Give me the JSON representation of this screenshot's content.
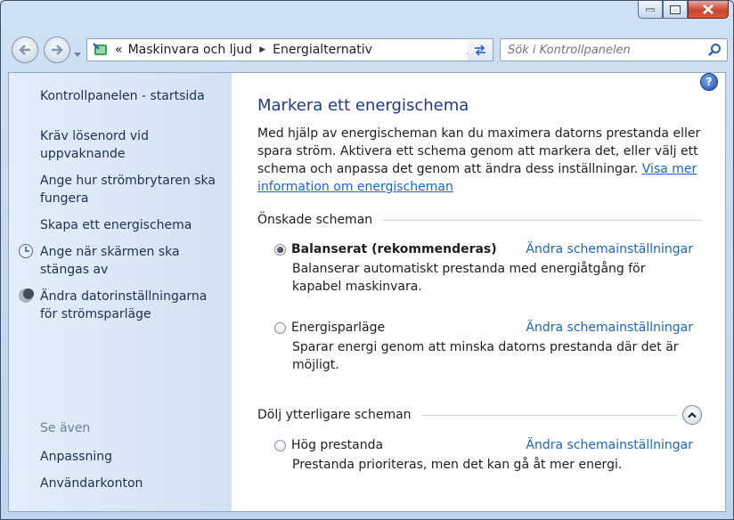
{
  "window": {
    "minimize_label": "minimize",
    "maximize_label": "maximize",
    "close_label": "close"
  },
  "address": {
    "overflow": "«",
    "breadcrumbs": [
      "Maskinvara och ljud",
      "Energialternativ"
    ]
  },
  "search": {
    "placeholder": "Sök i Kontrollpanelen"
  },
  "sidebar": {
    "home": "Kontrollpanelen - startsida",
    "items": [
      "Kräv lösenord vid uppvaknande",
      "Ange hur strömbrytaren ska fungera",
      "Skapa ett energischema",
      "Ange när skärmen ska stängas av",
      "Ändra datorinställningarna för strömsparläge"
    ],
    "see_also": "Se även",
    "see_also_items": [
      "Anpassning",
      "Användarkonton"
    ]
  },
  "main": {
    "help": "?",
    "title": "Markera ett energischema",
    "intro": "Med hjälp av energischeman kan du maximera datorns prestanda eller spara ström. Aktivera ett schema genom att markera det, eller välj ett schema och anpassa det genom att ändra dess inställningar.",
    "intro_link": "Visa mer information om energischeman",
    "preferred_label": "Önskade scheman",
    "hidden_label": "Dölj ytterligare scheman",
    "change_label": "Ändra schemainställningar",
    "schemes": [
      {
        "name": "Balanserat (rekommenderas)",
        "selected": true,
        "desc": "Balanserar automatiskt prestanda med energiåtgång för kapabel maskinvara."
      },
      {
        "name": "Energisparläge",
        "selected": false,
        "desc": "Sparar energi genom att minska datorns prestanda där det är möjligt."
      },
      {
        "name": "Hög prestanda",
        "selected": false,
        "desc": "Prestanda prioriteras, men det kan gå åt mer energi."
      }
    ]
  }
}
